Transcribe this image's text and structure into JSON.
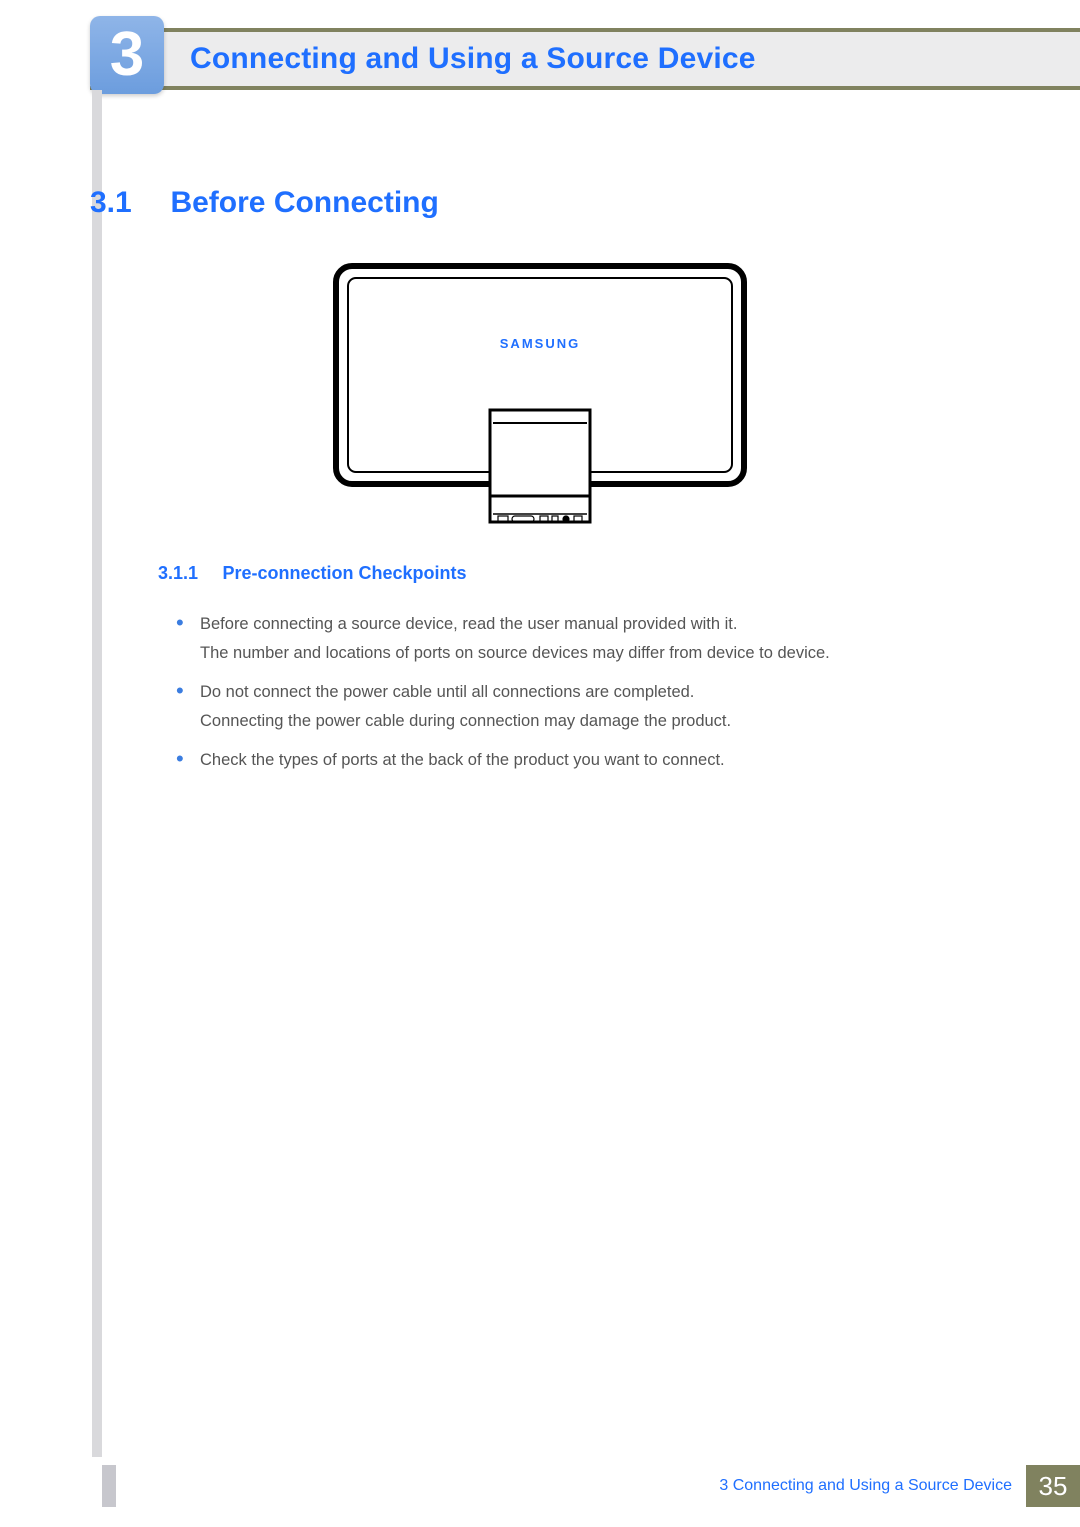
{
  "header": {
    "chapter_number": "3",
    "chapter_title": "Connecting and Using a Source Device"
  },
  "section": {
    "number": "3.1",
    "title": "Before Connecting"
  },
  "illustration": {
    "brand_label": "SAMSUNG"
  },
  "subsection": {
    "number": "3.1.1",
    "title": "Pre-connection Checkpoints"
  },
  "bullets": [
    {
      "line1": "Before connecting a source device, read the user manual provided with it.",
      "line2": "The number and locations of ports on source devices may differ from device to device."
    },
    {
      "line1": "Do not connect the power cable until all connections are completed.",
      "line2": "Connecting the power cable during connection may damage the product."
    },
    {
      "line1": "Check the types of ports at the back of the product you want to connect.",
      "line2": ""
    }
  ],
  "footer": {
    "text": "3 Connecting and Using a Source Device",
    "page": "35"
  }
}
